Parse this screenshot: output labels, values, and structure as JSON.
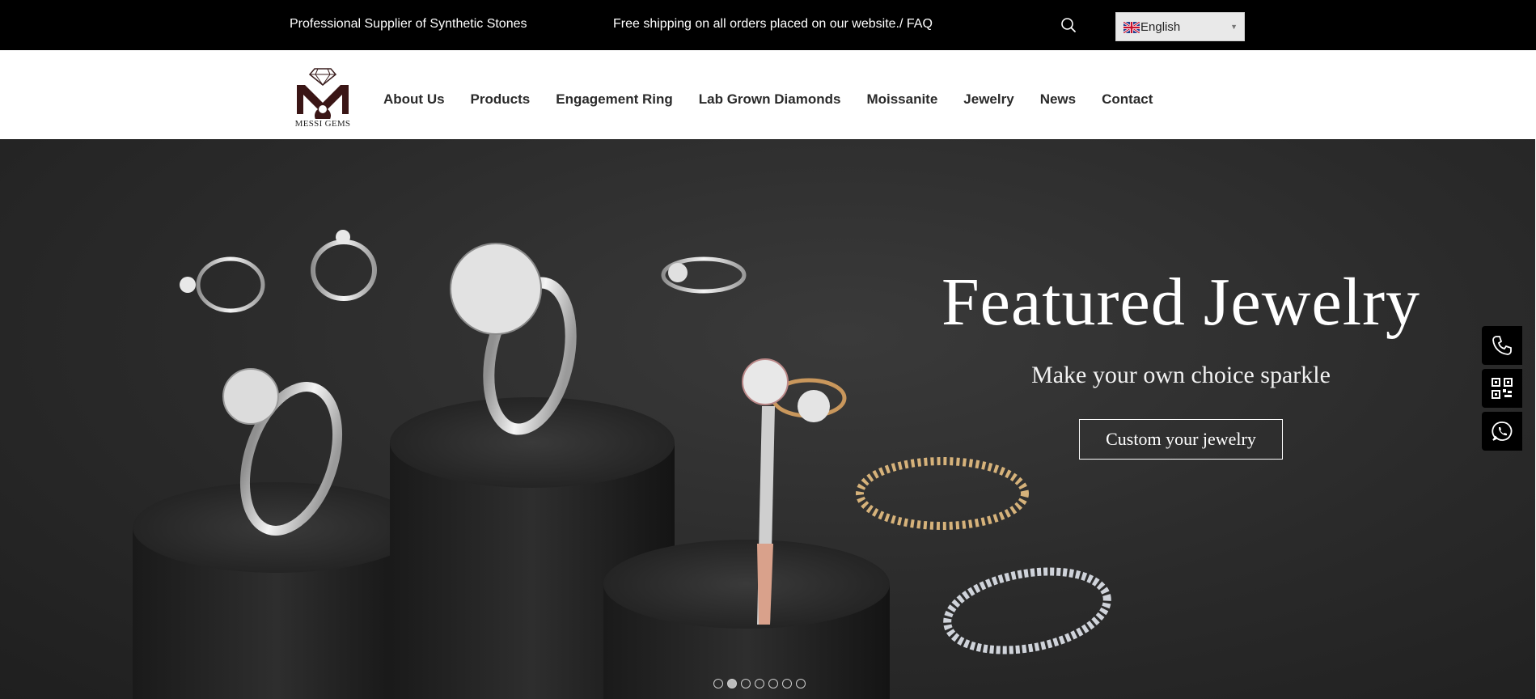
{
  "topbar": {
    "tagline": "Professional Supplier of Synthetic Stones",
    "shipping": "Free shipping on all orders placed on our website./ FAQ",
    "search_icon": "search-icon",
    "language": {
      "selected": "English",
      "flag_icon": "uk-flag-icon"
    }
  },
  "header": {
    "logo_text": "MESSI GEMS",
    "nav": [
      {
        "label": "About Us"
      },
      {
        "label": "Products"
      },
      {
        "label": "Engagement Ring"
      },
      {
        "label": "Lab Grown Diamonds"
      },
      {
        "label": "Moissanite"
      },
      {
        "label": "Jewelry"
      },
      {
        "label": "News"
      },
      {
        "label": "Contact"
      }
    ]
  },
  "hero": {
    "title": "Featured Jewelry",
    "subtitle": "Make your own choice sparkle",
    "button": "Custom your jewelry",
    "slides": {
      "count": 7,
      "active_index": 1
    }
  },
  "side_contact": [
    {
      "icon": "phone-icon"
    },
    {
      "icon": "qr-code-icon"
    },
    {
      "icon": "whatsapp-icon"
    }
  ],
  "colors": {
    "topbar_bg": "#000000",
    "hero_bg": "#2a2a2a",
    "nav_text": "#2a2a2a"
  }
}
